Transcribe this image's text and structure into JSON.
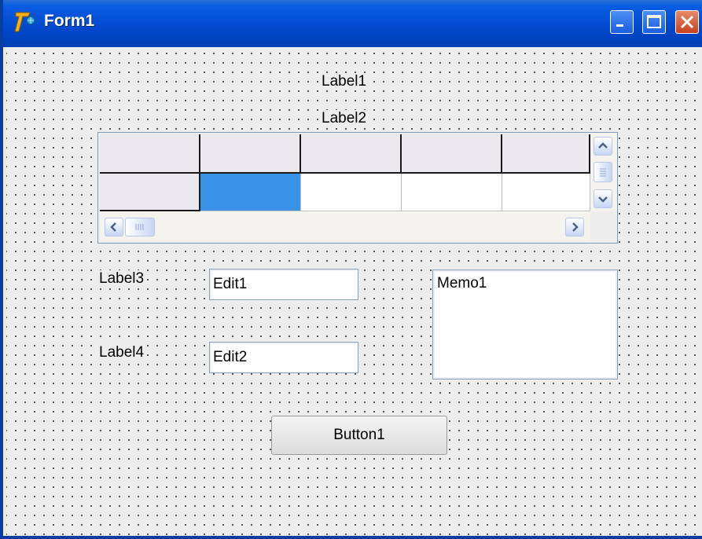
{
  "window": {
    "title": "Form1",
    "app_icon": "delphi-7-icon"
  },
  "titlebar_buttons": {
    "minimize": "minimize-icon",
    "maximize": "maximize-icon",
    "close": "close-icon"
  },
  "labels": {
    "label1": "Label1",
    "label2": "Label2",
    "label3": "Label3",
    "label4": "Label4"
  },
  "grid": {
    "columns": 5,
    "rows": 2,
    "fixed_rows": 1,
    "fixed_cols": 1,
    "selected_cell": [
      1,
      1
    ],
    "scrollbars": {
      "vertical": [
        "scroll-up-icon",
        "scroll-thumb-grip-icon",
        "scroll-down-icon"
      ],
      "horizontal": [
        "scroll-left-icon",
        "scroll-thumb-grip-icon",
        "scroll-right-icon"
      ]
    }
  },
  "edits": {
    "edit1": "Edit1",
    "edit2": "Edit2"
  },
  "memo": {
    "text": "Memo1"
  },
  "button": {
    "label": "Button1"
  },
  "colors": {
    "titlebar": "#0149cf",
    "selection": "#3992e6",
    "form_background": "#eeedee"
  }
}
